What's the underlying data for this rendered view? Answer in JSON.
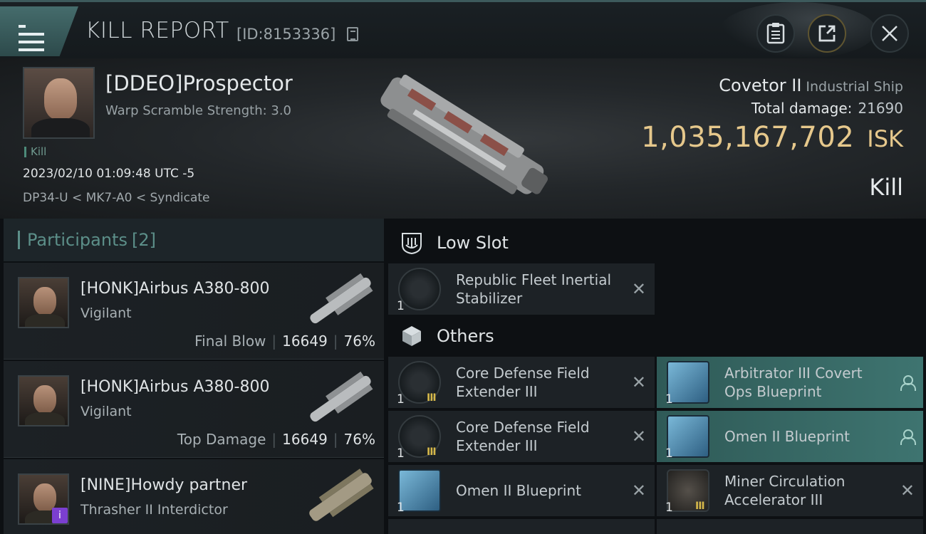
{
  "header": {
    "title": "KILL REPORT",
    "report_id": "[ID:8153336]"
  },
  "victim": {
    "name": "[DDEO]Prospector",
    "subtitle": "Warp Scramble Strength: 3.0",
    "tag": "Kill",
    "timestamp": "2023/02/10 01:09:48 UTC -5",
    "location": "DP34-U < MK7-A0 < Syndicate",
    "ship_name": "Covetor II",
    "ship_class": "Industrial Ship",
    "total_damage_label": "Total damage:",
    "total_damage": "21690",
    "isk_value": "1,035,167,702",
    "isk_unit": "ISK",
    "result": "Kill"
  },
  "participants": {
    "label": "Participants",
    "count": "[2]",
    "items": [
      {
        "name": "[HONK]Airbus A380-800",
        "ship": "Vigilant",
        "role": "Final Blow",
        "damage": "16649",
        "percent": "76%"
      },
      {
        "name": "[HONK]Airbus A380-800",
        "ship": "Vigilant",
        "role": "Top Damage",
        "damage": "16649",
        "percent": "76%"
      },
      {
        "name": "[NINE]Howdy partner",
        "ship": "Thrasher II Interdictor",
        "badge": "i"
      }
    ]
  },
  "sections": {
    "low_slot": "Low Slot",
    "others": "Others"
  },
  "low_slot_items": [
    {
      "name": "Republic Fleet Inertial Stabilizer",
      "qty": "1"
    }
  ],
  "other_items": [
    {
      "name": "Core Defense Field Extender III",
      "qty": "1",
      "meta": "III"
    },
    {
      "name": "Arbitrator III Covert Ops Blueprint",
      "qty": "1"
    },
    {
      "name": "Core Defense Field Extender III",
      "qty": "1",
      "meta": "III"
    },
    {
      "name": "Omen II Blueprint",
      "qty": "1"
    },
    {
      "name": "Omen II Blueprint",
      "qty": "1"
    },
    {
      "name": "Miner Circulation Accelerator III",
      "qty": "1",
      "meta": "III"
    }
  ],
  "icons": {
    "menu": "menu-icon",
    "copy": "copy-icon",
    "report": "clipboard-icon",
    "share": "share-icon",
    "close": "close-icon",
    "remove": "x-icon",
    "owner": "person-icon"
  },
  "colors": {
    "accent_teal": "#5c8f89",
    "isk_gold": "#e6c88c",
    "highlight_row": "#3e7470"
  }
}
